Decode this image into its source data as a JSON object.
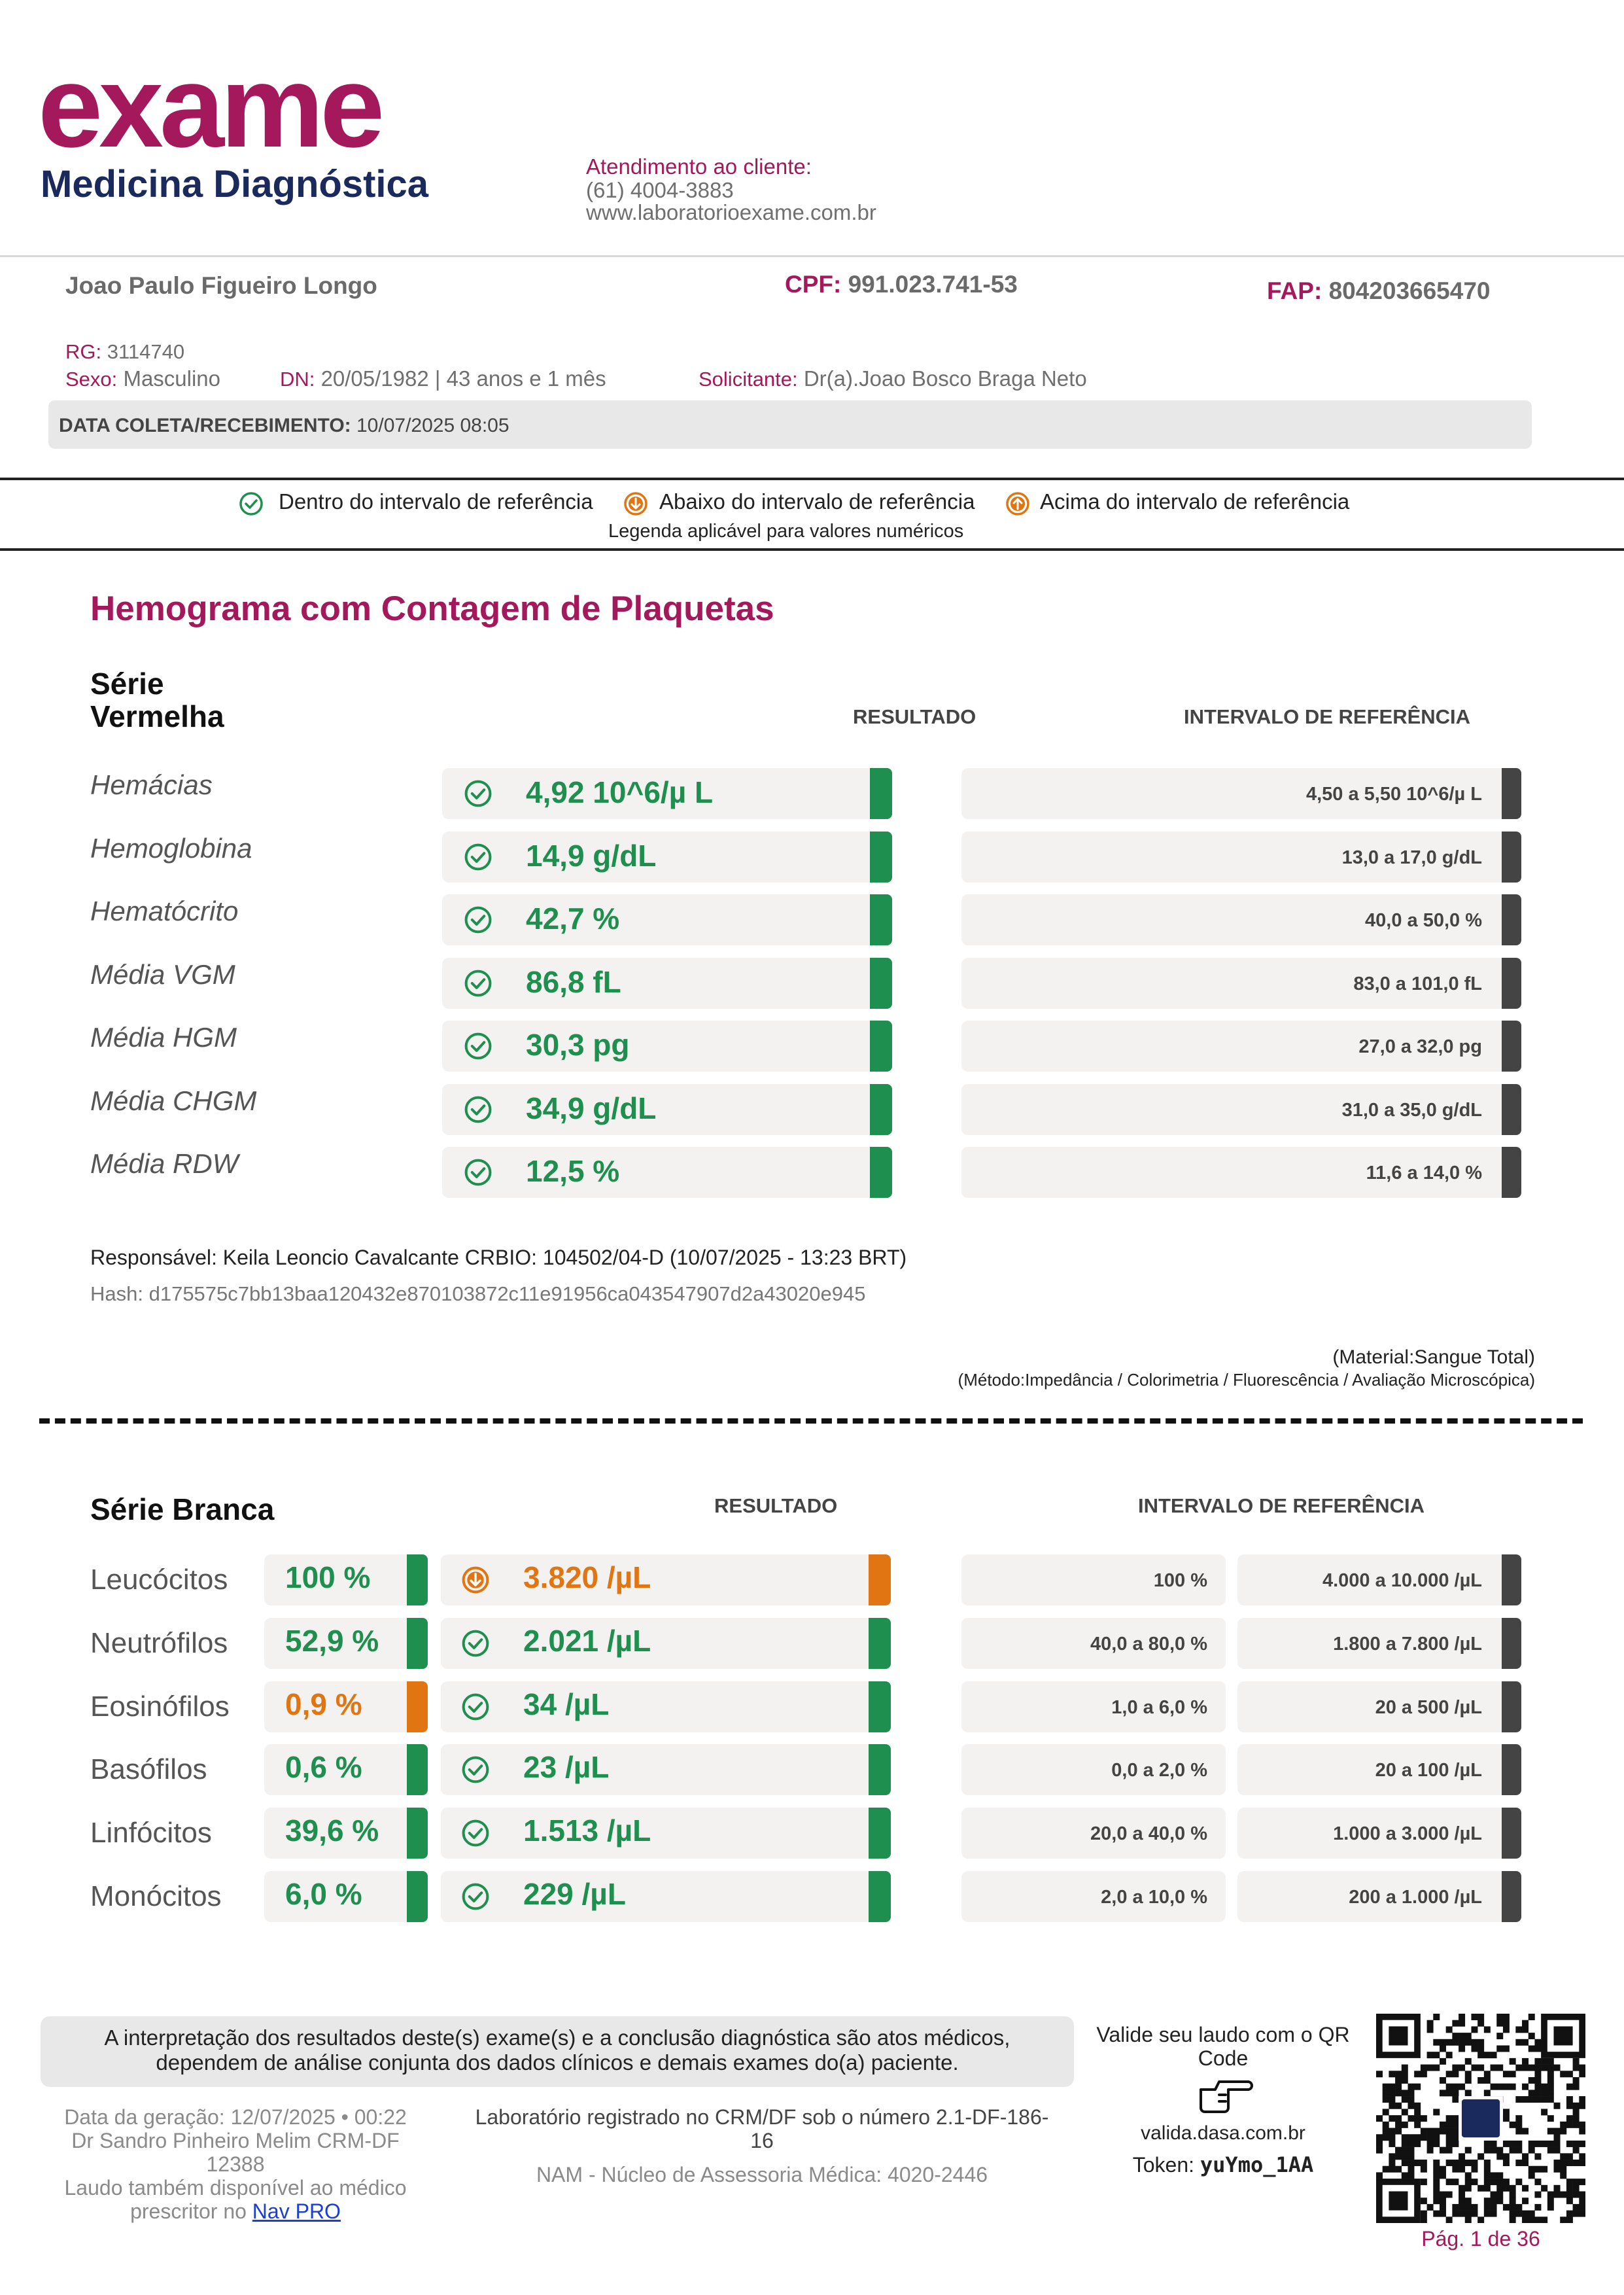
{
  "header": {
    "logo_main": "exame",
    "logo_sub": "Medicina Diagnóstica",
    "contact_title": "Atendimento ao cliente:",
    "contact_phone": "(61) 4004-3883",
    "contact_site": "www.laboratorioexame.com.br"
  },
  "patient": {
    "name": "Joao Paulo Figueiro Longo",
    "cpf_label": "CPF:",
    "cpf": "991.023.741-53",
    "fap_label": "FAP:",
    "fap": "804203665470",
    "rg_label": "RG:",
    "rg": "3114740",
    "sex_label": "Sexo:",
    "sex": "Masculino",
    "dn_label": "DN:",
    "dn": "20/05/1982 | 43 anos e 1 mês",
    "requester_label": "Solicitante:",
    "requester": "Dr(a).Joao Bosco Braga Neto",
    "collection_label": "DATA COLETA/RECEBIMENTO:",
    "collection": "10/07/2025 08:05"
  },
  "legend": {
    "within": "Dentro do intervalo de referência",
    "below": "Abaixo do intervalo de referência",
    "above": "Acima do intervalo de referência",
    "note": "Legenda aplicável para valores numéricos"
  },
  "exam": {
    "title": "Hemograma com Contagem de Plaquetas",
    "red": {
      "title_line1": "Série",
      "title_line2": "Vermelha",
      "result_header": "RESULTADO",
      "ref_header": "INTERVALO DE REFERÊNCIA",
      "rows": [
        {
          "name": "Hemácias",
          "result": "4,92 10^6/µ L",
          "status": "within",
          "ref": "4,50 a 5,50 10^6/µ L"
        },
        {
          "name": "Hemoglobina",
          "result": "14,9 g/dL",
          "status": "within",
          "ref": "13,0 a 17,0 g/dL"
        },
        {
          "name": "Hematócrito",
          "result": "42,7 %",
          "status": "within",
          "ref": "40,0 a 50,0 %"
        },
        {
          "name": "Média VGM",
          "result": "86,8 fL",
          "status": "within",
          "ref": "83,0 a 101,0 fL"
        },
        {
          "name": "Média HGM",
          "result": "30,3 pg",
          "status": "within",
          "ref": "27,0 a 32,0 pg"
        },
        {
          "name": "Média CHGM",
          "result": "34,9 g/dL",
          "status": "within",
          "ref": "31,0 a 35,0 g/dL"
        },
        {
          "name": "Média RDW",
          "result": "12,5 %",
          "status": "within",
          "ref": "11,6 a 14,0 %"
        }
      ],
      "responsible": "Responsável: Keila Leoncio Cavalcante CRBIO: 104502/04-D (10/07/2025 - 13:23 BRT)",
      "hash": "Hash: d175575c7bb13baa120432e870103872c11e91956ca043547907d2a43020e945",
      "material": "(Material:Sangue Total)",
      "method": "(Método:Impedância / Colorimetria / Fluorescência / Avaliação Microscópica)"
    },
    "white": {
      "title": "Série Branca",
      "result_header": "RESULTADO",
      "ref_header": "INTERVALO DE REFERÊNCIA",
      "rows": [
        {
          "name": "Leucócitos",
          "pct": "100 %",
          "pct_status": "within",
          "abs": "3.820 /µL",
          "abs_status": "below",
          "ref_pct": "100 %",
          "ref_abs": "4.000 a 10.000 /µL"
        },
        {
          "name": "Neutrófilos",
          "pct": "52,9 %",
          "pct_status": "within",
          "abs": "2.021 /µL",
          "abs_status": "within",
          "ref_pct": "40,0 a 80,0 %",
          "ref_abs": "1.800 a 7.800 /µL"
        },
        {
          "name": "Eosinófilos",
          "pct": "0,9 %",
          "pct_status": "below",
          "abs": "34 /µL",
          "abs_status": "within",
          "ref_pct": "1,0 a 6,0 %",
          "ref_abs": "20 a 500 /µL"
        },
        {
          "name": "Basófilos",
          "pct": "0,6 %",
          "pct_status": "within",
          "abs": "23 /µL",
          "abs_status": "within",
          "ref_pct": "0,0 a 2,0 %",
          "ref_abs": "20 a 100 /µL"
        },
        {
          "name": "Linfócitos",
          "pct": "39,6 %",
          "pct_status": "within",
          "abs": "1.513 /µL",
          "abs_status": "within",
          "ref_pct": "20,0 a 40,0 %",
          "ref_abs": "1.000 a 3.000 /µL"
        },
        {
          "name": "Monócitos",
          "pct": "6,0 %",
          "pct_status": "within",
          "abs": "229 /µL",
          "abs_status": "within",
          "ref_pct": "2,0 a 10,0 %",
          "ref_abs": "200 a 1.000 /µL"
        }
      ]
    }
  },
  "footer": {
    "disclaimer_l1": "A interpretação dos resultados deste(s) exame(s) e a conclusão diagnóstica são atos médicos,",
    "disclaimer_l2": "dependem de análise conjunta dos dados clínicos e demais exames do(a) paciente.",
    "gen_date": "Data da geração: 12/07/2025 • 00:22",
    "doctor_l1": "Dr Sandro Pinheiro Melim CRM-DF",
    "doctor_l2": "12388",
    "avail_l1": "Laudo também disponível ao médico",
    "avail_l2": "prescritor no",
    "nav_link": "Nav PRO",
    "lab_l1": "Laboratório registrado no CRM/DF sob o número 2.1-DF-186-",
    "lab_l2": "16",
    "nam": "NAM - Núcleo de Assessoria Médica: 4020-2446",
    "validate_l1": "Valide seu laudo com o QR",
    "validate_l2": "Code",
    "validate_url": "valida.dasa.com.br",
    "token_label": "Token:",
    "token": "yuYmo_1AA",
    "page": "Pág. 1 de 36"
  },
  "colors": {
    "within": "#1e8f4e",
    "below": "#e07511",
    "brand": "#a3195b",
    "navy": "#1b2a5c"
  }
}
